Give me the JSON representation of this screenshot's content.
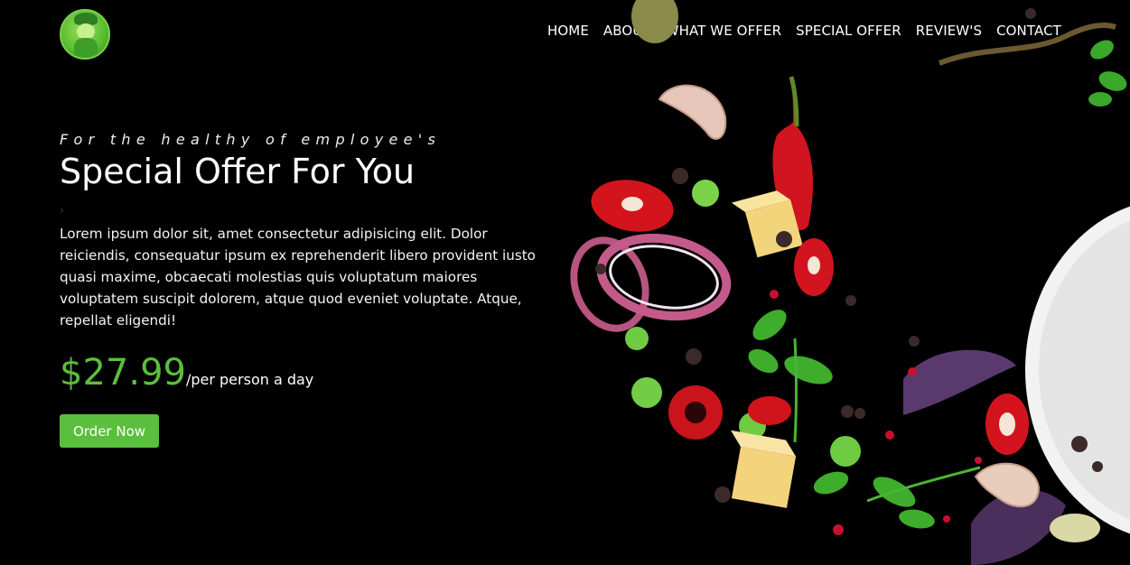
{
  "nav": {
    "items": [
      "HOME",
      "ABOUT",
      "WHAT WE OFFER",
      "SPECIAL OFFER",
      "REVIEW'S",
      "CONTACT"
    ]
  },
  "hero": {
    "tagline": "For the healthy of employee's",
    "title": "Special Offer For You",
    "chevron": "›",
    "description": "Lorem ipsum dolor sit, amet consectetur adipisicing elit. Dolor reiciendis, consequatur ipsum ex reprehenderit libero provident iusto quasi maxime, obcaecati molestias quis voluptatum maiores voluptatem suscipit dolorem, atque quod eveniet voluptate. Atque, repellat eligendi!",
    "price": "$27.99",
    "price_unit": "/per person a day",
    "order_button": "Order Now"
  },
  "colors": {
    "accent": "#5abf3c",
    "background": "#000000"
  }
}
